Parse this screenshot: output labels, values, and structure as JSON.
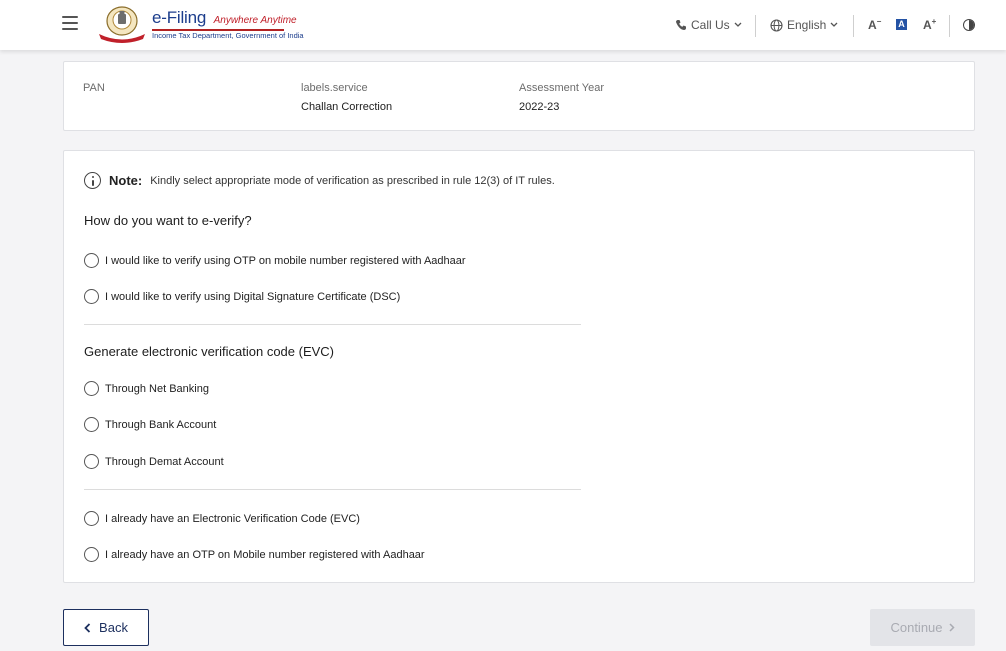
{
  "header": {
    "brand_title": "e-Filing",
    "brand_tagline": "Anywhere Anytime",
    "brand_subtitle": "Income Tax Department, Government of India",
    "call_us": "Call Us",
    "language": "English",
    "font_decrease": "A",
    "font_normal": "A",
    "font_increase": "A"
  },
  "info": {
    "pan_label": "PAN",
    "pan_value": "",
    "service_label": "labels.service",
    "service_value": "Challan Correction",
    "ay_label": "Assessment Year",
    "ay_value": "2022-23"
  },
  "note": {
    "bold": "Note:",
    "text": "Kindly select appropriate mode of verification as prescribed in rule 12(3) of IT rules."
  },
  "sections": {
    "everify_title": "How do you want to e-verify?",
    "everify_options": [
      "I would like to verify using OTP on mobile number registered with Aadhaar",
      "I would like to verify using Digital Signature Certificate (DSC)"
    ],
    "evc_title": "Generate electronic verification code (EVC)",
    "evc_options": [
      "Through Net Banking",
      "Through Bank Account",
      "Through Demat Account"
    ],
    "existing_options": [
      "I already have an Electronic Verification Code (EVC)",
      "I already have an OTP on Mobile number registered with Aadhaar"
    ]
  },
  "buttons": {
    "back": "Back",
    "continue": "Continue"
  },
  "colors": {
    "brand_blue": "#1c3d8c",
    "brand_red": "#c0202a",
    "back_border": "#1c2f5e",
    "continue_disabled_bg": "#e3e4e8"
  }
}
